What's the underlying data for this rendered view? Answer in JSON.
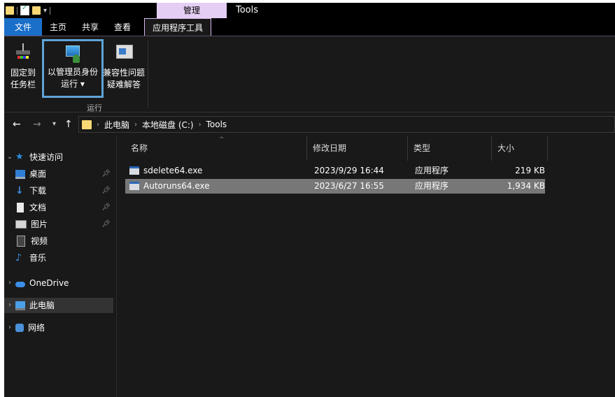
{
  "titlebar": {
    "context_tab": "管理",
    "context_title": "Tools"
  },
  "tabs": [
    {
      "label": "文件"
    },
    {
      "label": "主页"
    },
    {
      "label": "共享"
    },
    {
      "label": "查看"
    },
    {
      "label": "应用程序工具"
    }
  ],
  "ribbon": {
    "pin_line1": "固定到",
    "pin_line2": "任务栏",
    "run_admin_line1": "以管理员身份",
    "run_admin_line2": "运行 ▾",
    "compat_line1": "兼容性问题",
    "compat_line2": "疑难解答",
    "group_label": "运行"
  },
  "address": {
    "crumbs": [
      "此电脑",
      "本地磁盘 (C:)",
      "Tools"
    ]
  },
  "nav": {
    "quick_access": "快速访问",
    "items": [
      {
        "label": "桌面",
        "icon": "desktop-icon"
      },
      {
        "label": "下载",
        "icon": "download-icon"
      },
      {
        "label": "文档",
        "icon": "documents-icon"
      },
      {
        "label": "图片",
        "icon": "pictures-icon"
      },
      {
        "label": "视频",
        "icon": "videos-icon"
      },
      {
        "label": "音乐",
        "icon": "music-icon"
      }
    ],
    "onedrive": "OneDrive",
    "this_pc": "此电脑",
    "network": "网络"
  },
  "columns": {
    "name": "名称",
    "date": "修改日期",
    "type": "类型",
    "size": "大小"
  },
  "files": [
    {
      "name": "sdelete64.exe",
      "date": "2023/9/29 16:44",
      "type": "应用程序",
      "size": "219 KB"
    },
    {
      "name": "Autoruns64.exe",
      "date": "2023/6/27 16:55",
      "type": "应用程序",
      "size": "1,934 KB"
    }
  ],
  "colors": {
    "file_tab": "#1a6fc9",
    "context_tab": "#e4cef3",
    "highlight_box": "#5fa3d6",
    "selected_row": "#777777"
  }
}
